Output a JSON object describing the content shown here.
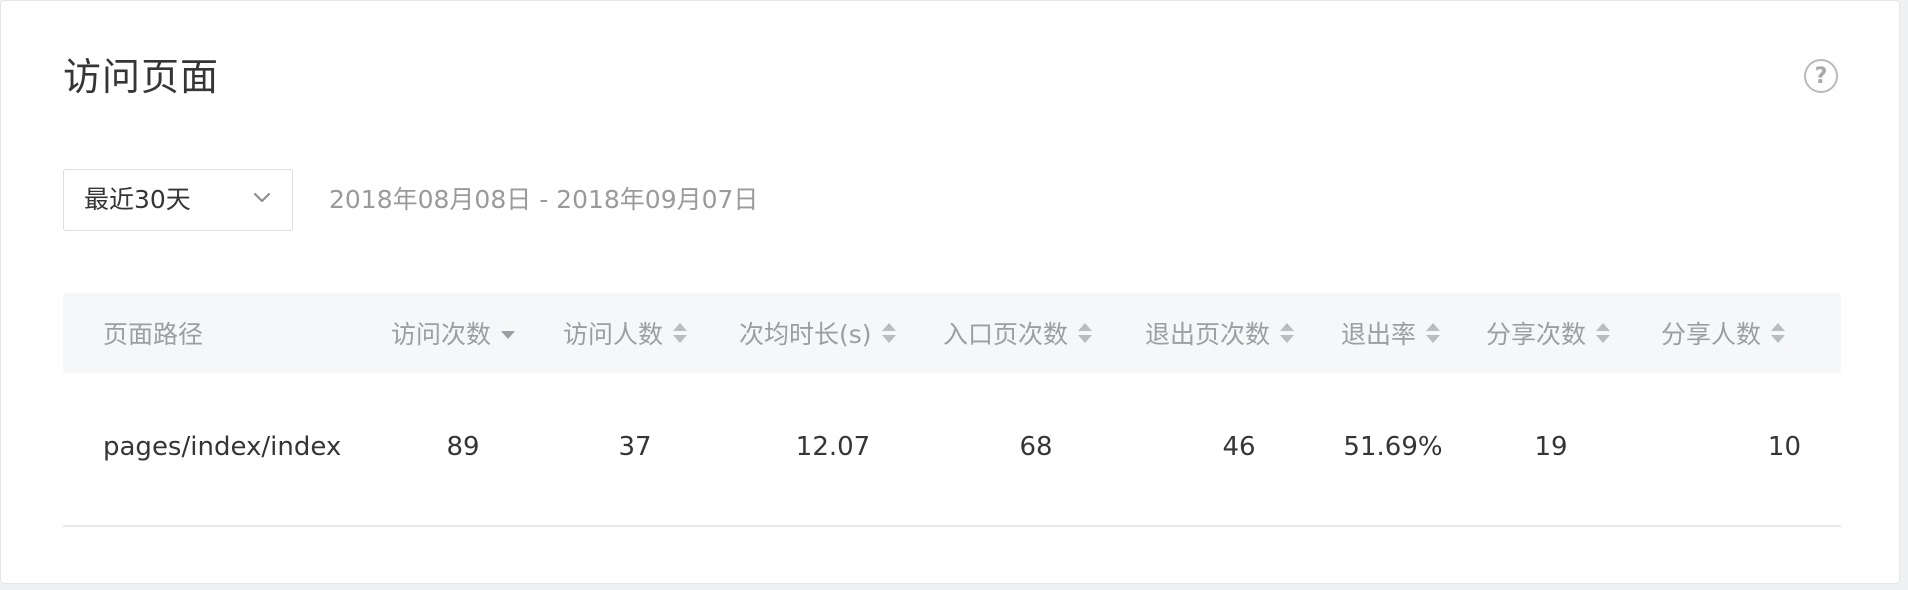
{
  "card": {
    "title": "访问页面",
    "help_icon": "question-circle-icon"
  },
  "filter": {
    "range_select": "最近30天",
    "range_icon": "chevron-down-icon",
    "date_range": "2018年08月08日 - 2018年09月07日"
  },
  "table": {
    "columns": [
      {
        "label": "页面路径",
        "sort": "none"
      },
      {
        "label": "访问次数",
        "sort": "desc"
      },
      {
        "label": "访问人数",
        "sort": "both"
      },
      {
        "label": "次均时长(s)",
        "sort": "both"
      },
      {
        "label": "入口页次数",
        "sort": "both"
      },
      {
        "label": "退出页次数",
        "sort": "both"
      },
      {
        "label": "退出率",
        "sort": "both"
      },
      {
        "label": "分享次数",
        "sort": "both"
      },
      {
        "label": "分享人数",
        "sort": "both"
      }
    ],
    "rows": [
      [
        "pages/index/index",
        "89",
        "37",
        "12.07",
        "68",
        "46",
        "51.69%",
        "19",
        "10"
      ]
    ]
  },
  "colors": {
    "header_bg": "#f6f7f8",
    "header_text": "#9b9ea3",
    "date_text": "#9a9a9a",
    "body_text": "#353535"
  }
}
